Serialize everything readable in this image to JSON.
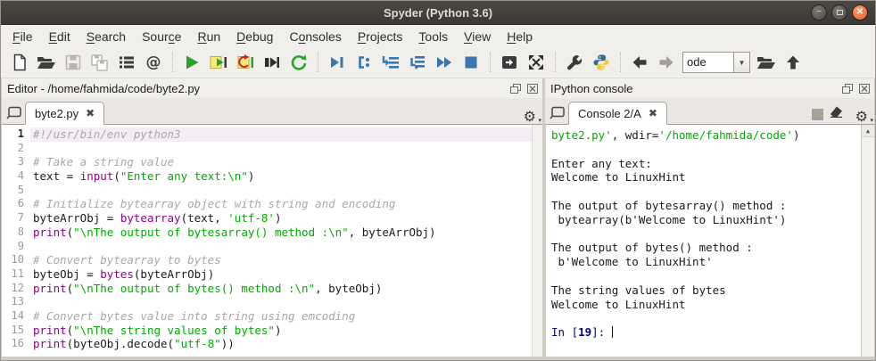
{
  "window": {
    "title": "Spyder (Python 3.6)",
    "controls": [
      "minimize",
      "maximize",
      "close"
    ]
  },
  "menubar": {
    "items": [
      {
        "label": "File",
        "mnemonic_index": 0
      },
      {
        "label": "Edit",
        "mnemonic_index": 0
      },
      {
        "label": "Search",
        "mnemonic_index": 0
      },
      {
        "label": "Source",
        "mnemonic_index": 4
      },
      {
        "label": "Run",
        "mnemonic_index": 0
      },
      {
        "label": "Debug",
        "mnemonic_index": 0
      },
      {
        "label": "Consoles",
        "mnemonic_index": 1
      },
      {
        "label": "Projects",
        "mnemonic_index": 0
      },
      {
        "label": "Tools",
        "mnemonic_index": 0
      },
      {
        "label": "View",
        "mnemonic_index": 0
      },
      {
        "label": "Help",
        "mnemonic_index": 0
      }
    ]
  },
  "toolbar": {
    "working_dir_value": "ode",
    "icons": [
      "new-file-icon",
      "open-file-icon",
      "save-icon",
      "save-all-icon",
      "file-switcher-icon",
      "find-symbols-icon",
      "run-file-icon",
      "run-cell-icon",
      "rerun-cell-icon",
      "run-selection-icon",
      "rerun-icon",
      "debug-file-icon",
      "debug-step-icon",
      "debug-step-into-icon",
      "debug-step-return-icon",
      "debug-continue-icon",
      "debug-stop-icon",
      "maximize-pane-icon",
      "fullscreen-icon",
      "preferences-wrench-icon",
      "python-path-icon",
      "back-icon",
      "forward-icon",
      "working-dir-combobox",
      "open-dir-icon",
      "parent-dir-icon"
    ]
  },
  "editor": {
    "header_title": "Editor - /home/fahmida/code/byte2.py",
    "tab": {
      "label": "byte2.py",
      "close_glyph": "✖"
    },
    "code": {
      "current_line": 1,
      "lines": [
        [
          {
            "c": "comment",
            "t": "#!/usr/bin/env python3"
          }
        ],
        [],
        [
          {
            "c": "comment",
            "t": "# Take a string value"
          }
        ],
        [
          {
            "c": "plain",
            "t": "text = "
          },
          {
            "c": "kw",
            "t": "input"
          },
          {
            "c": "plain",
            "t": "("
          },
          {
            "c": "str",
            "t": "\"Enter any text:\\n\""
          },
          {
            "c": "plain",
            "t": ")"
          }
        ],
        [],
        [
          {
            "c": "comment",
            "t": "# Initialize bytearray object with string and encoding"
          }
        ],
        [
          {
            "c": "plain",
            "t": "byteArrObj = "
          },
          {
            "c": "kw",
            "t": "bytearray"
          },
          {
            "c": "plain",
            "t": "(text, "
          },
          {
            "c": "str",
            "t": "'utf-8'"
          },
          {
            "c": "plain",
            "t": ")"
          }
        ],
        [
          {
            "c": "kw",
            "t": "print"
          },
          {
            "c": "plain",
            "t": "("
          },
          {
            "c": "str",
            "t": "\"\\nThe output of bytesarray() method :\\n\""
          },
          {
            "c": "plain",
            "t": ", byteArrObj)"
          }
        ],
        [],
        [
          {
            "c": "comment",
            "t": "# Convert bytearray to bytes"
          }
        ],
        [
          {
            "c": "plain",
            "t": "byteObj = "
          },
          {
            "c": "kw",
            "t": "bytes"
          },
          {
            "c": "plain",
            "t": "(byteArrObj)"
          }
        ],
        [
          {
            "c": "kw",
            "t": "print"
          },
          {
            "c": "plain",
            "t": "("
          },
          {
            "c": "str",
            "t": "\"\\nThe output of bytes() method :\\n\""
          },
          {
            "c": "plain",
            "t": ", byteObj)"
          }
        ],
        [],
        [
          {
            "c": "comment",
            "t": "# Convert bytes value into string using emcoding"
          }
        ],
        [
          {
            "c": "kw",
            "t": "print"
          },
          {
            "c": "plain",
            "t": "("
          },
          {
            "c": "str",
            "t": "\"\\nThe string values of bytes\""
          },
          {
            "c": "plain",
            "t": ")"
          }
        ],
        [
          {
            "c": "kw",
            "t": "print"
          },
          {
            "c": "plain",
            "t": "(byteObj.decode("
          },
          {
            "c": "str",
            "t": "\"utf-8\""
          },
          {
            "c": "plain",
            "t": "))"
          }
        ]
      ]
    }
  },
  "console_panel": {
    "header_title": "IPython console",
    "tab": {
      "label": "Console 2/A",
      "close_glyph": "✖"
    },
    "lines": [
      [
        {
          "c": "str",
          "t": "byte2.py'"
        },
        {
          "c": "plain",
          "t": ", wdir="
        },
        {
          "c": "str",
          "t": "'/home/fahmida/code'"
        },
        {
          "c": "plain",
          "t": ")"
        }
      ],
      [],
      [
        {
          "c": "plain",
          "t": "Enter any text:"
        }
      ],
      [
        {
          "c": "plain",
          "t": "Welcome to LinuxHint"
        }
      ],
      [],
      [
        {
          "c": "plain",
          "t": "The output of bytesarray() method :"
        }
      ],
      [
        {
          "c": "plain",
          "t": " bytearray(b'Welcome to LinuxHint')"
        }
      ],
      [],
      [
        {
          "c": "plain",
          "t": "The output of bytes() method :"
        }
      ],
      [
        {
          "c": "plain",
          "t": " b'Welcome to LinuxHint'"
        }
      ],
      [],
      [
        {
          "c": "plain",
          "t": "The string values of bytes"
        }
      ],
      [
        {
          "c": "plain",
          "t": "Welcome to LinuxHint"
        }
      ],
      [],
      [
        {
          "c": "prompt",
          "t": "In ["
        },
        {
          "c": "prompt-num",
          "t": "19"
        },
        {
          "c": "prompt",
          "t": "]: "
        },
        {
          "c": "cursor",
          "t": ""
        }
      ]
    ]
  },
  "colors": {
    "titlebar": "#3b3733",
    "close_button": "#e8602c",
    "keyword": "#900090",
    "string": "#00aa00",
    "comment": "#aaa8a6",
    "prompt": "#000080",
    "debug_blue": "#3b76ad",
    "run_green": "#2aa12a",
    "current_line_bg": "#f5ecf5"
  }
}
